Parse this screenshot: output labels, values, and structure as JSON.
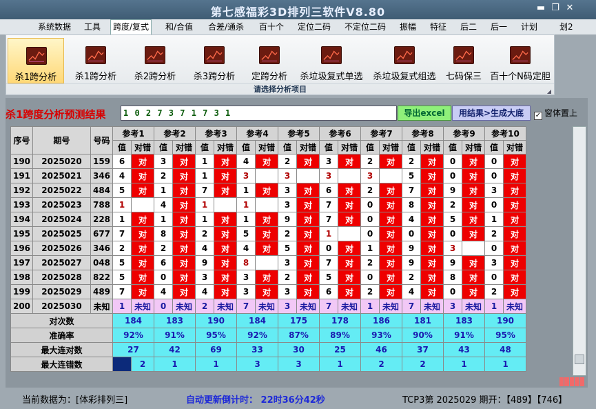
{
  "window": {
    "title": "第七感福彩3D排列三软件V8.80",
    "minimize": "▬",
    "restore": "❐",
    "close": "✕"
  },
  "menu": [
    "系统数据",
    "工具",
    "跨度/复式",
    "和/合值",
    "合差/通杀",
    "百十个",
    "定位二码",
    "不定位二码",
    "振幅",
    "特征",
    "后二",
    "后一",
    "计划",
    "划2"
  ],
  "ribbon": {
    "buttons": [
      "杀1跨分析",
      "杀1跨分析",
      "杀2跨分析",
      "杀3跨分析",
      "定跨分析",
      "杀垃圾复式单选",
      "杀垃圾复式组选",
      "七码保三",
      "百十个N码定胆"
    ],
    "group_label": "请选择分析项目",
    "icon": "chart-icon"
  },
  "result": {
    "label": "杀1跨度分析预测结果",
    "value": "1 0 2 7 3 7 1 7 3 1",
    "excel_button": "导出excel",
    "generate_button": "用结果>生成大底",
    "ontop_label": "窗体置上",
    "ontop_checked": true
  },
  "table": {
    "header_row": [
      "序号",
      "期号",
      "号码"
    ],
    "refs": [
      "参考1",
      "参考2",
      "参考3",
      "参考4",
      "参考5",
      "参考6",
      "参考7",
      "参考8",
      "参考9",
      "参考10"
    ],
    "sub_headers": [
      "值",
      "对错"
    ],
    "rows": [
      {
        "seq": "190",
        "period": "2025020",
        "num": "159",
        "vals": [
          "6",
          "3",
          "1",
          "4",
          "2",
          "3",
          "2",
          "2",
          "0",
          "0"
        ],
        "marks": [
          "对",
          "对",
          "对",
          "对",
          "对",
          "对",
          "对",
          "对",
          "对",
          "对"
        ]
      },
      {
        "seq": "191",
        "period": "2025021",
        "num": "346",
        "vals": [
          "4",
          "2",
          "1",
          "3",
          "3",
          "3",
          "3",
          "5",
          "0",
          "0"
        ],
        "marks": [
          "对",
          "对",
          "对",
          "",
          "",
          "",
          "",
          "对",
          "对",
          "对"
        ]
      },
      {
        "seq": "192",
        "period": "2025022",
        "num": "484",
        "vals": [
          "5",
          "1",
          "7",
          "1",
          "3",
          "6",
          "2",
          "7",
          "9",
          "3"
        ],
        "marks": [
          "对",
          "对",
          "对",
          "对",
          "对",
          "对",
          "对",
          "对",
          "对",
          "对"
        ]
      },
      {
        "seq": "193",
        "period": "2025023",
        "num": "788",
        "vals": [
          "1",
          "4",
          "1",
          "1",
          "3",
          "7",
          "0",
          "8",
          "2",
          "0"
        ],
        "marks": [
          "",
          "对",
          "",
          "",
          "对",
          "对",
          "对",
          "对",
          "对",
          "对"
        ]
      },
      {
        "seq": "194",
        "period": "2025024",
        "num": "228",
        "vals": [
          "1",
          "1",
          "1",
          "1",
          "9",
          "7",
          "0",
          "4",
          "5",
          "1"
        ],
        "marks": [
          "对",
          "对",
          "对",
          "对",
          "对",
          "对",
          "对",
          "对",
          "对",
          "对"
        ]
      },
      {
        "seq": "195",
        "period": "2025025",
        "num": "677",
        "vals": [
          "7",
          "8",
          "2",
          "5",
          "2",
          "1",
          "0",
          "0",
          "0",
          "2"
        ],
        "marks": [
          "对",
          "对",
          "对",
          "对",
          "对",
          "",
          "对",
          "对",
          "对",
          "对"
        ]
      },
      {
        "seq": "196",
        "period": "2025026",
        "num": "346",
        "vals": [
          "2",
          "2",
          "4",
          "4",
          "5",
          "0",
          "1",
          "9",
          "3",
          "0"
        ],
        "marks": [
          "对",
          "对",
          "对",
          "对",
          "对",
          "对",
          "对",
          "对",
          "",
          "对"
        ]
      },
      {
        "seq": "197",
        "period": "2025027",
        "num": "048",
        "vals": [
          "5",
          "6",
          "9",
          "8",
          "3",
          "7",
          "2",
          "9",
          "9",
          "3"
        ],
        "marks": [
          "对",
          "对",
          "对",
          "",
          "对",
          "对",
          "对",
          "对",
          "对",
          "对"
        ]
      },
      {
        "seq": "198",
        "period": "2025028",
        "num": "822",
        "vals": [
          "5",
          "0",
          "3",
          "3",
          "2",
          "5",
          "0",
          "2",
          "8",
          "0"
        ],
        "marks": [
          "对",
          "对",
          "对",
          "对",
          "对",
          "对",
          "对",
          "对",
          "对",
          "对"
        ]
      },
      {
        "seq": "199",
        "period": "2025029",
        "num": "489",
        "vals": [
          "7",
          "4",
          "4",
          "3",
          "3",
          "6",
          "2",
          "4",
          "0",
          "2"
        ],
        "marks": [
          "对",
          "对",
          "对",
          "对",
          "对",
          "对",
          "对",
          "对",
          "对",
          "对"
        ]
      },
      {
        "seq": "200",
        "period": "2025030",
        "num": "未知",
        "vals": [
          "1",
          "0",
          "2",
          "7",
          "3",
          "7",
          "1",
          "7",
          "3",
          "1"
        ],
        "marks": [
          "未知",
          "未知",
          "未知",
          "未知",
          "未知",
          "未知",
          "未知",
          "未知",
          "未知",
          "未知"
        ]
      }
    ],
    "stats": [
      {
        "label": "对次数",
        "values": [
          "184",
          "183",
          "190",
          "184",
          "175",
          "178",
          "186",
          "181",
          "183",
          "190"
        ]
      },
      {
        "label": "准确率",
        "values": [
          "92%",
          "91%",
          "95%",
          "92%",
          "87%",
          "89%",
          "93%",
          "90%",
          "91%",
          "95%"
        ]
      },
      {
        "label": "最大连对数",
        "values": [
          "27",
          "42",
          "69",
          "33",
          "30",
          "25",
          "46",
          "37",
          "43",
          "48"
        ]
      },
      {
        "label": "最大连错数",
        "values": [
          "2",
          "1",
          "1",
          "3",
          "3",
          "1",
          "2",
          "2",
          "1",
          "1"
        ]
      }
    ]
  },
  "status": {
    "current": "当前数据为：[体彩排列三]",
    "countdown": "自动更新倒计时： 22时36分42秒",
    "draw": "TCP3第 2025029 期开：【489】【746】"
  }
}
